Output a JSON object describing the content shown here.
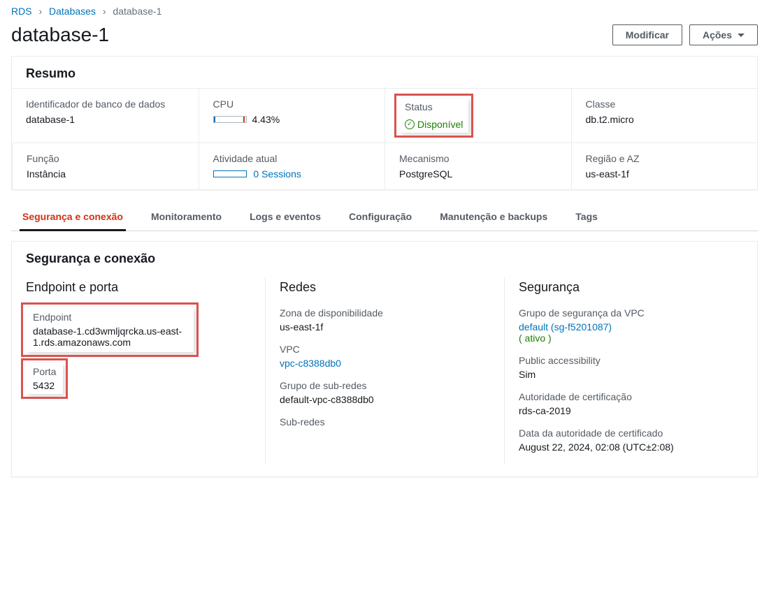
{
  "breadcrumb": {
    "root": "RDS",
    "parent": "Databases",
    "current": "database-1"
  },
  "header": {
    "title": "database-1",
    "modify_label": "Modificar",
    "actions_label": "Ações"
  },
  "summary": {
    "title": "Resumo",
    "db_identifier_label": "Identificador de banco de dados",
    "db_identifier_value": "database-1",
    "cpu_label": "CPU",
    "cpu_value": "4.43%",
    "status_label": "Status",
    "status_value": "Disponível",
    "class_label": "Classe",
    "class_value": "db.t2.micro",
    "role_label": "Função",
    "role_value": "Instância",
    "activity_label": "Atividade atual",
    "activity_value": "0 Sessions",
    "engine_label": "Mecanismo",
    "engine_value": "PostgreSQL",
    "region_label": "Região e AZ",
    "region_value": "us-east-1f"
  },
  "tabs": {
    "security": "Segurança e conexão",
    "monitoring": "Monitoramento",
    "logs": "Logs e eventos",
    "config": "Configuração",
    "maintenance": "Manutenção e backups",
    "tags": "Tags"
  },
  "detail": {
    "panel_title": "Segurança e conexão",
    "endpoint_port_heading": "Endpoint e porta",
    "endpoint_label": "Endpoint",
    "endpoint_value": "database-1.cd3wmljqrcka.us-east-1.rds.amazonaws.com",
    "port_label": "Porta",
    "port_value": "5432",
    "networks_heading": "Redes",
    "az_label": "Zona de disponibilidade",
    "az_value": "us-east-1f",
    "vpc_label": "VPC",
    "vpc_value": "vpc-c8388db0",
    "subnet_group_label": "Grupo de sub-redes",
    "subnet_group_value": "default-vpc-c8388db0",
    "subnets_label": "Sub-redes",
    "security_heading": "Segurança",
    "sg_label": "Grupo de segurança da VPC",
    "sg_value": "default (sg-f5201087)",
    "sg_active": "( ativo )",
    "public_label": "Public accessibility",
    "public_value": "Sim",
    "ca_label": "Autoridade de certificação",
    "ca_value": "rds-ca-2019",
    "ca_date_label": "Data da autoridade de certificado",
    "ca_date_value": "August 22, 2024, 02:08 (UTC±2:08)"
  }
}
